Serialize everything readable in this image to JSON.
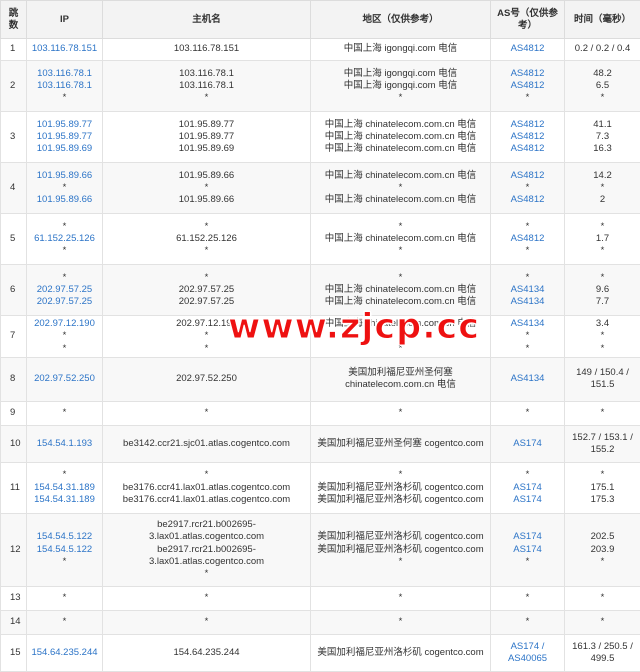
{
  "headers": {
    "hop": "跳数",
    "ip": "IP",
    "host": "主机名",
    "region": "地区（仅供参考）",
    "as": "AS号（仅供参考）",
    "time": "时间（毫秒）"
  },
  "rows": [
    {
      "hop": "1",
      "ips": [
        "103.116.78.151"
      ],
      "hosts": [
        "103.116.78.151"
      ],
      "regions": [
        "中国上海 igongqi.com 电信"
      ],
      "as": [
        "AS4812"
      ],
      "times": [
        "0.2 / 0.2 / 0.4"
      ]
    },
    {
      "hop": "2",
      "ips": [
        "103.116.78.1",
        "103.116.78.1",
        "*"
      ],
      "hosts": [
        "103.116.78.1",
        "103.116.78.1",
        "*"
      ],
      "regions": [
        "中国上海 igongqi.com 电信",
        "中国上海 igongqi.com 电信",
        "*"
      ],
      "as": [
        "AS4812",
        "AS4812",
        "*"
      ],
      "times": [
        "48.2",
        "6.5",
        "*"
      ]
    },
    {
      "hop": "3",
      "ips": [
        "101.95.89.77",
        "101.95.89.77",
        "101.95.89.69"
      ],
      "hosts": [
        "101.95.89.77",
        "101.95.89.77",
        "101.95.89.69"
      ],
      "regions": [
        "中国上海 chinatelecom.com.cn 电信",
        "中国上海 chinatelecom.com.cn 电信",
        "中国上海 chinatelecom.com.cn 电信"
      ],
      "as": [
        "AS4812",
        "AS4812",
        "AS4812"
      ],
      "times": [
        "41.1",
        "7.3",
        "16.3"
      ]
    },
    {
      "hop": "4",
      "ips": [
        "101.95.89.66",
        "*",
        "101.95.89.66"
      ],
      "hosts": [
        "101.95.89.66",
        "*",
        "101.95.89.66"
      ],
      "regions": [
        "中国上海 chinatelecom.com.cn 电信",
        "*",
        "中国上海 chinatelecom.com.cn 电信"
      ],
      "as": [
        "AS4812",
        "*",
        "AS4812"
      ],
      "times": [
        "14.2",
        "*",
        "2"
      ]
    },
    {
      "hop": "5",
      "ips": [
        "*",
        "61.152.25.126",
        "*"
      ],
      "hosts": [
        "*",
        "61.152.25.126",
        "*"
      ],
      "regions": [
        "*",
        "中国上海 chinatelecom.com.cn 电信",
        "*"
      ],
      "as": [
        "*",
        "AS4812",
        "*"
      ],
      "times": [
        "*",
        "1.7",
        "*"
      ]
    },
    {
      "hop": "6",
      "ips": [
        "*",
        "202.97.57.25",
        "202.97.57.25"
      ],
      "hosts": [
        "*",
        "202.97.57.25",
        "202.97.57.25"
      ],
      "regions": [
        "*",
        "中国上海 chinatelecom.com.cn 电信",
        "中国上海 chinatelecom.com.cn 电信"
      ],
      "as": [
        "*",
        "AS4134",
        "AS4134"
      ],
      "times": [
        "*",
        "9.6",
        "7.7"
      ]
    },
    {
      "hop": "7",
      "ips": [
        "202.97.12.190",
        "*",
        "*"
      ],
      "hosts": [
        "202.97.12.190",
        "*",
        "*"
      ],
      "regions": [
        "中国上海 chinatelecom.com.cn 电信",
        "*",
        "*"
      ],
      "as": [
        "AS4134",
        "*",
        "*"
      ],
      "times": [
        "3.4",
        "*",
        "*"
      ]
    },
    {
      "hop": "8",
      "ips": [
        "202.97.52.250"
      ],
      "hosts": [
        "202.97.52.250"
      ],
      "regions": [
        "美国加利福尼亚州圣何塞",
        "chinatelecom.com.cn 电信"
      ],
      "as": [
        "AS4134"
      ],
      "times": [
        "149 / 150.4 /",
        "151.5"
      ]
    },
    {
      "hop": "9",
      "ips": [
        "*"
      ],
      "hosts": [
        "*"
      ],
      "regions": [
        "*"
      ],
      "as": [
        "*"
      ],
      "times": [
        "*"
      ]
    },
    {
      "hop": "10",
      "ips": [
        "154.54.1.193"
      ],
      "hosts": [
        "be3142.ccr21.sjc01.atlas.cogentco.com"
      ],
      "regions": [
        "美国加利福尼亚州圣何塞 cogentco.com"
      ],
      "as": [
        "AS174"
      ],
      "times": [
        "152.7 / 153.1 /",
        "155.2"
      ]
    },
    {
      "hop": "11",
      "ips": [
        "*",
        "154.54.31.189",
        "154.54.31.189"
      ],
      "hosts": [
        "*",
        "be3176.ccr41.lax01.atlas.cogentco.com",
        "be3176.ccr41.lax01.atlas.cogentco.com"
      ],
      "regions": [
        "*",
        "美国加利福尼亚州洛杉矶 cogentco.com",
        "美国加利福尼亚州洛杉矶 cogentco.com"
      ],
      "as": [
        "*",
        "AS174",
        "AS174"
      ],
      "times": [
        "*",
        "175.1",
        "175.3"
      ]
    },
    {
      "hop": "12",
      "ips": [
        "154.54.5.122",
        "154.54.5.122",
        "*"
      ],
      "hosts": [
        "be2917.rcr21.b002695-",
        "3.lax01.atlas.cogentco.com",
        "be2917.rcr21.b002695-",
        "3.lax01.atlas.cogentco.com",
        "*"
      ],
      "regions": [
        "美国加利福尼亚州洛杉矶 cogentco.com",
        "美国加利福尼亚州洛杉矶 cogentco.com",
        "*"
      ],
      "as": [
        "AS174",
        "AS174",
        "*"
      ],
      "times": [
        "202.5",
        "203.9",
        "*"
      ]
    },
    {
      "hop": "13",
      "ips": [
        "*"
      ],
      "hosts": [
        "*"
      ],
      "regions": [
        "*"
      ],
      "as": [
        "*"
      ],
      "times": [
        "*"
      ]
    },
    {
      "hop": "14",
      "ips": [
        "*"
      ],
      "hosts": [
        "*"
      ],
      "regions": [
        "*"
      ],
      "as": [
        "*"
      ],
      "times": [
        "*"
      ]
    },
    {
      "hop": "15",
      "ips": [
        "154.64.235.244"
      ],
      "hosts": [
        "154.64.235.244"
      ],
      "regions": [
        "美国加利福尼亚州洛杉矶 cogentco.com"
      ],
      "as": [
        "AS174 /",
        "AS40065"
      ],
      "times": [
        "161.3 / 250.5 /",
        "499.5"
      ]
    }
  ],
  "watermark": "www.zjcp.cc",
  "colors": {
    "link": "#2c74c7",
    "header_bg": "#f3f3f3",
    "stripe_bg": "#f8f8f8",
    "watermark": "#ee1111"
  }
}
